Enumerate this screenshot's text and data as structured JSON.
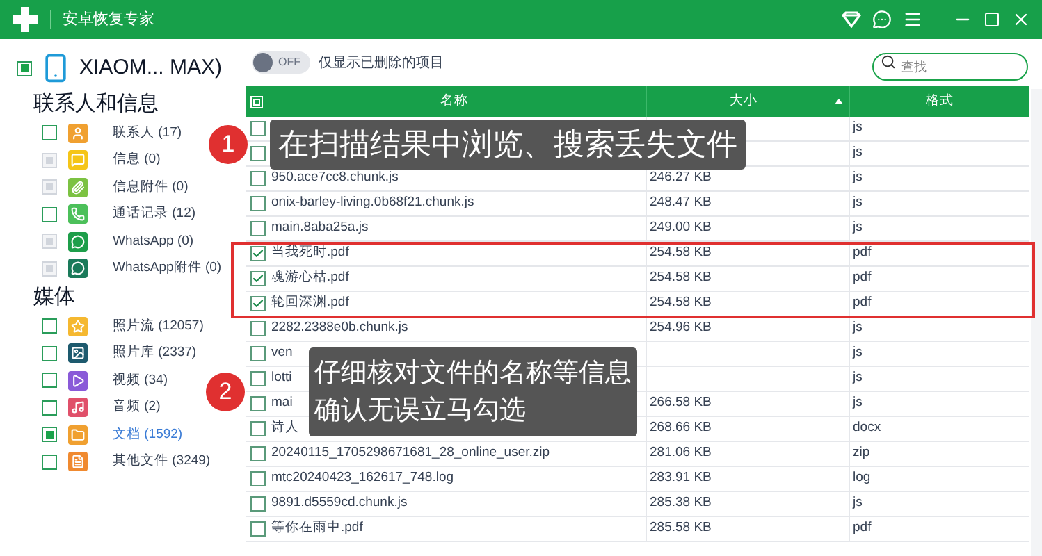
{
  "window": {
    "title": "安卓恢复专家"
  },
  "device": {
    "name": "XIAOM... MAX)",
    "checked": true
  },
  "groups": [
    {
      "title": "联系人和信息",
      "items": [
        {
          "label": "联系人 (17)",
          "checked": false,
          "disabled": false,
          "selected": false,
          "color": "#f0a030"
        },
        {
          "label": "信息 (0)",
          "checked": false,
          "disabled": true,
          "selected": false,
          "color": "#f5c518"
        },
        {
          "label": "信息附件 (0)",
          "checked": false,
          "disabled": true,
          "selected": false,
          "color": "#7cc242"
        },
        {
          "label": "通话记录 (12)",
          "checked": false,
          "disabled": false,
          "selected": false,
          "color": "#4cc05a"
        },
        {
          "label": "WhatsApp (0)",
          "checked": false,
          "disabled": true,
          "selected": false,
          "color": "#1e9e4a"
        },
        {
          "label": "WhatsApp附件 (0)",
          "checked": false,
          "disabled": true,
          "selected": false,
          "color": "#1a7a5a"
        }
      ]
    },
    {
      "title": "媒体",
      "items": [
        {
          "label": "照片流 (12057)",
          "checked": false,
          "disabled": false,
          "selected": false,
          "color": "#f5b830"
        },
        {
          "label": "照片库 (2337)",
          "checked": false,
          "disabled": false,
          "selected": false,
          "color": "#1d5a6e"
        },
        {
          "label": "视频 (34)",
          "checked": false,
          "disabled": false,
          "selected": false,
          "color": "#8a5ad8"
        },
        {
          "label": "音频 (2)",
          "checked": false,
          "disabled": false,
          "selected": false,
          "color": "#e0506a"
        },
        {
          "label": "文档 (1592)",
          "checked": true,
          "disabled": false,
          "selected": true,
          "color": "#f0a030"
        },
        {
          "label": "其他文件 (3249)",
          "checked": false,
          "disabled": false,
          "selected": false,
          "color": "#f08a30"
        }
      ]
    }
  ],
  "filter": {
    "on": false,
    "switch_label": "OFF",
    "label": "仅显示已删除的项目"
  },
  "search": {
    "placeholder": "查找"
  },
  "table": {
    "header_checked": true,
    "columns": [
      "名称",
      "大小",
      "格式"
    ],
    "rows": [
      {
        "checked": false,
        "format": "js"
      },
      {
        "checked": false,
        "format": "js"
      },
      {
        "checked": false,
        "name": "950.ace7cc8.chunk.js",
        "size": "246.27 KB",
        "format": "js"
      },
      {
        "checked": false,
        "name": "onix-barley-living.0b68f21.chunk.js",
        "size": "248.47 KB",
        "format": "js"
      },
      {
        "checked": false,
        "name": "main.8aba25a.js",
        "size": "249.00 KB",
        "format": "js"
      },
      {
        "checked": true,
        "name": "当我死时.pdf",
        "size": "254.58 KB",
        "format": "pdf"
      },
      {
        "checked": true,
        "name": "魂游心枯.pdf",
        "size": "254.58 KB",
        "format": "pdf"
      },
      {
        "checked": true,
        "name": "轮回深渊.pdf",
        "size": "254.58 KB",
        "format": "pdf"
      },
      {
        "checked": false,
        "name": "2282.2388e0b.chunk.js",
        "size": "254.96 KB",
        "format": "js"
      },
      {
        "checked": false,
        "name": "ven",
        "format": "js"
      },
      {
        "checked": false,
        "name": "lotti",
        "format": "js"
      },
      {
        "checked": false,
        "name": "mai",
        "size": "266.58 KB",
        "format": "js"
      },
      {
        "checked": false,
        "name": "诗人",
        "size": "268.66 KB",
        "format": "docx"
      },
      {
        "checked": false,
        "name": "20240115_1705298671681_28_online_user.zip",
        "size": "281.06 KB",
        "format": "zip"
      },
      {
        "checked": false,
        "name": "mtc20240423_162617_748.log",
        "size": "283.91 KB",
        "format": "log"
      },
      {
        "checked": false,
        "name": "9891.d5559cd.chunk.js",
        "size": "285.38 KB",
        "format": "js"
      },
      {
        "checked": false,
        "name": "等你在雨中.pdf",
        "size": "285.58 KB",
        "format": "pdf"
      }
    ]
  },
  "callouts": [
    {
      "number": "1",
      "lines": [
        "在扫描结果中浏览、搜索丢失文件"
      ]
    },
    {
      "number": "2",
      "lines": [
        "仔细核对文件的名称等信息",
        "确认无误立马勾选"
      ]
    }
  ]
}
